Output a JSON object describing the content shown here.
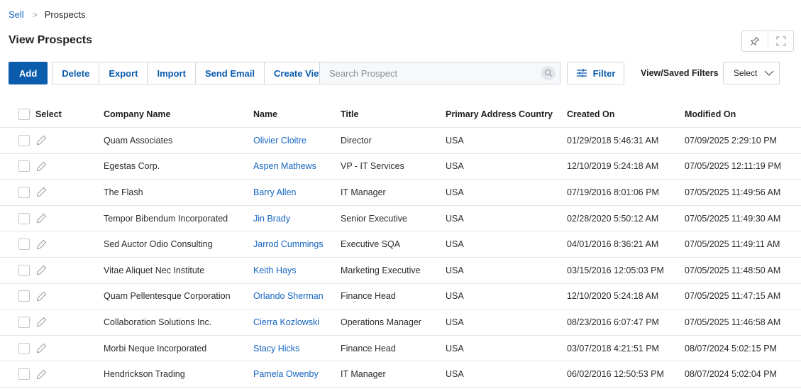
{
  "breadcrumb": {
    "parent": "Sell",
    "separator": ">",
    "current": "Prospects"
  },
  "page_title": "View Prospects",
  "corner_icons": [
    "pin-icon",
    "expand-icon"
  ],
  "toolbar": {
    "add": "Add",
    "delete": "Delete",
    "export": "Export",
    "import": "Import",
    "send_email": "Send Email",
    "create_view": "Create View"
  },
  "search": {
    "placeholder": "Search Prospect",
    "value": ""
  },
  "filter": {
    "label": "Filter",
    "icon": "sliders-icon"
  },
  "saved_filters": {
    "label": "View/Saved Filters",
    "selected": "Select"
  },
  "colors": {
    "accent": "#0b5cad",
    "link": "#1565c0",
    "border": "#cfd6de"
  },
  "table": {
    "headers": {
      "select": "Select",
      "company": "Company Name",
      "name": "Name",
      "title": "Title",
      "country": "Primary Address Country",
      "created": "Created On",
      "modified": "Modified On"
    },
    "rows": [
      {
        "company": "Quam Associates",
        "name": "Olivier Cloitre",
        "title": "Director",
        "country": "USA",
        "created": "01/29/2018 5:46:31 AM",
        "modified": "07/09/2025 2:29:10 PM"
      },
      {
        "company": "Egestas Corp.",
        "name": "Aspen Mathews",
        "title": "VP - IT Services",
        "country": "USA",
        "created": "12/10/2019 5:24:18 AM",
        "modified": "07/05/2025 12:11:19 PM"
      },
      {
        "company": "The Flash",
        "name": "Barry Allen",
        "title": "IT Manager",
        "country": "USA",
        "created": "07/19/2016 8:01:06 PM",
        "modified": "07/05/2025 11:49:56 AM"
      },
      {
        "company": "Tempor Bibendum Incorporated",
        "name": "Jin Brady",
        "title": "Senior Executive",
        "country": "USA",
        "created": "02/28/2020 5:50:12 AM",
        "modified": "07/05/2025 11:49:30 AM"
      },
      {
        "company": "Sed Auctor Odio Consulting",
        "name": "Jarrod Cummings",
        "title": "Executive SQA",
        "country": "USA",
        "created": "04/01/2016 8:36:21 AM",
        "modified": "07/05/2025 11:49:11 AM"
      },
      {
        "company": "Vitae Aliquet Nec Institute",
        "name": "Keith Hays",
        "title": "Marketing Executive",
        "country": "USA",
        "created": "03/15/2016 12:05:03 PM",
        "modified": "07/05/2025 11:48:50 AM"
      },
      {
        "company": "Quam Pellentesque Corporation",
        "name": "Orlando Sherman",
        "title": "Finance Head",
        "country": "USA",
        "created": "12/10/2020 5:24:18 AM",
        "modified": "07/05/2025 11:47:15 AM"
      },
      {
        "company": "Collaboration Solutions Inc.",
        "name": "Cierra Kozlowski",
        "title": "Operations Manager",
        "country": "USA",
        "created": "08/23/2016 6:07:47 PM",
        "modified": "07/05/2025 11:46:58 AM"
      },
      {
        "company": "Morbi Neque Incorporated",
        "name": "Stacy Hicks",
        "title": "Finance Head",
        "country": "USA",
        "created": "03/07/2018 4:21:51 PM",
        "modified": "08/07/2024 5:02:15 PM"
      },
      {
        "company": "Hendrickson Trading",
        "name": "Pamela Owenby",
        "title": "IT Manager",
        "country": "USA",
        "created": "06/02/2016 12:50:53 PM",
        "modified": "08/07/2024 5:02:04 PM"
      }
    ]
  }
}
